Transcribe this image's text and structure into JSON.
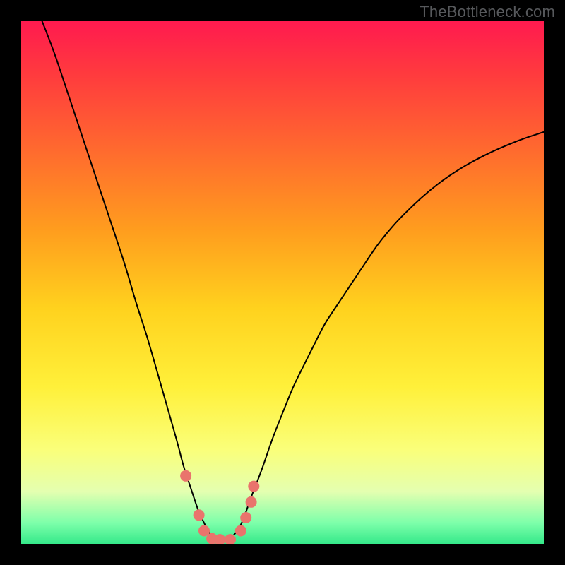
{
  "watermark": "TheBottleneck.com",
  "chart_data": {
    "type": "line",
    "title": "",
    "xlabel": "",
    "ylabel": "",
    "xlim": [
      0,
      100
    ],
    "ylim": [
      0,
      100
    ],
    "grid": false,
    "gradient_bg": {
      "stops": [
        {
          "offset": 0.0,
          "color": "#ff1a4f"
        },
        {
          "offset": 0.1,
          "color": "#ff3a3e"
        },
        {
          "offset": 0.25,
          "color": "#ff6b2e"
        },
        {
          "offset": 0.4,
          "color": "#ff9d1e"
        },
        {
          "offset": 0.55,
          "color": "#ffd21e"
        },
        {
          "offset": 0.7,
          "color": "#fff03a"
        },
        {
          "offset": 0.82,
          "color": "#faff7a"
        },
        {
          "offset": 0.9,
          "color": "#e4ffb0"
        },
        {
          "offset": 0.96,
          "color": "#7dffaa"
        },
        {
          "offset": 1.0,
          "color": "#35e98a"
        }
      ]
    },
    "series": [
      {
        "name": "curve",
        "stroke": "#000000",
        "stroke_width": 2,
        "x": [
          4,
          6,
          8,
          10,
          12,
          14,
          16,
          18,
          20,
          22,
          24,
          26,
          28,
          30,
          31,
          32,
          33,
          34,
          35,
          36,
          37,
          38,
          39,
          40,
          41,
          42,
          43,
          44,
          46,
          48,
          50,
          52,
          54,
          56,
          58,
          60,
          62,
          64,
          66,
          68,
          70,
          72,
          75,
          78,
          81,
          84,
          87,
          90,
          93,
          96,
          100
        ],
        "y": [
          100,
          95,
          89,
          83,
          77,
          71,
          65,
          59,
          53,
          46,
          40,
          33,
          26,
          19,
          15,
          12,
          9,
          6,
          4,
          2,
          1.2,
          0.8,
          0.8,
          1,
          2,
          3.5,
          6,
          9,
          14,
          20,
          25,
          30,
          34,
          38,
          42,
          45,
          48,
          51,
          54,
          57,
          59.5,
          61.8,
          64.8,
          67.5,
          69.8,
          71.8,
          73.5,
          75,
          76.3,
          77.5,
          78.8
        ]
      },
      {
        "name": "markers",
        "stroke": "#e9746c",
        "marker_radius": 8,
        "x": [
          31.5,
          34,
          35,
          36.5,
          38,
          40,
          42,
          43,
          44,
          44.5
        ],
        "y": [
          13,
          5.5,
          2.5,
          1,
          0.8,
          0.8,
          2.5,
          5,
          8,
          11
        ]
      }
    ]
  }
}
